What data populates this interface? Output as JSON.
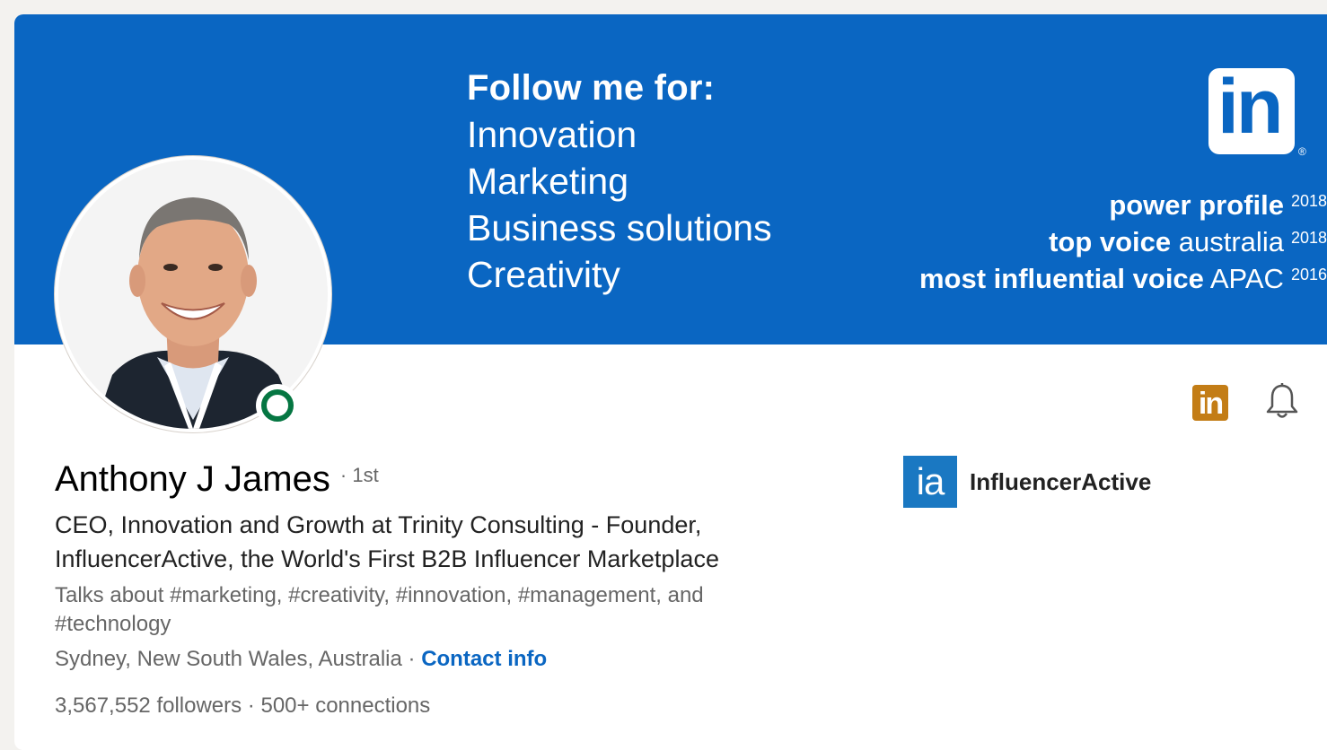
{
  "banner": {
    "heading": "Follow me for:",
    "topics": [
      "Innovation",
      "Marketing",
      "Business solutions",
      "Creativity"
    ],
    "logo_text": "in",
    "logo_reg": "®",
    "awards": [
      {
        "bold": "power profile",
        "rest": "",
        "year": "2018"
      },
      {
        "bold": "top voice",
        "rest": " australia",
        "year": "2018"
      },
      {
        "bold": "most influential voice",
        "rest": " APAC",
        "year": "2016"
      }
    ]
  },
  "profile": {
    "name": "Anthony J James",
    "degree": "· 1st",
    "headline": "CEO, Innovation and Growth at Trinity Consulting - Founder, InfluencerActive, the World's First B2B Influencer Marketplace",
    "talks_about": "Talks about #marketing, #creativity, #innovation, #management, and #technology",
    "location": "Sydney, New South Wales, Australia",
    "location_sep": " · ",
    "contact_info": "Contact info",
    "followers": "3,567,552 followers",
    "stats_sep": " · ",
    "connections": "500+ connections"
  },
  "company": {
    "logo_text": "ia",
    "name": "InfluencerActive"
  },
  "actions": {
    "badge_text": "in",
    "bell_icon": "bell-icon"
  },
  "colors": {
    "banner_blue": "#0a66c2",
    "link_blue": "#0a66c2",
    "online_green": "#057642",
    "gold": "#c37d16"
  }
}
